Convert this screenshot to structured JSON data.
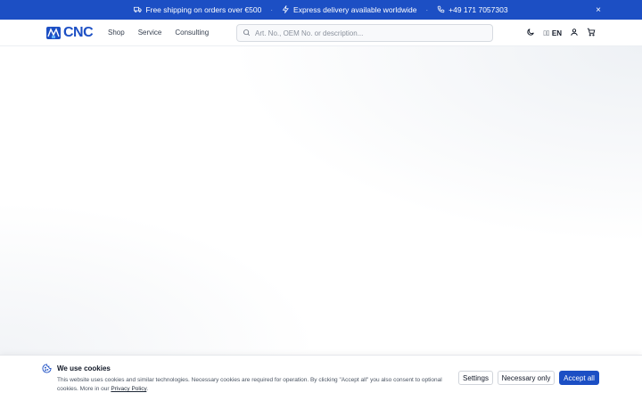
{
  "topbar": {
    "shipping": "Free shipping on orders over €500",
    "delivery": "Express delivery available worldwide",
    "phone": "+49 171 7057303",
    "separator": "·",
    "close": "×"
  },
  "header": {
    "logo_text": "CNC",
    "nav": [
      "Shop",
      "Service",
      "Consulting"
    ],
    "search_placeholder": "Art. No., OEM No. or description...",
    "language_flag": "▯▯",
    "language": "EN"
  },
  "cookie": {
    "title": "We use cookies",
    "text": "This website uses cookies and similar technologies. Necessary cookies are required for operation. By clicking \"Accept all\" you also consent to optional cookies. More in our ",
    "link": "Privacy Policy",
    "text_end": ".",
    "settings": "Settings",
    "necessary": "Necessary only",
    "accept": "Accept all"
  },
  "colors": {
    "brand": "#1c4fc4",
    "accent": "#1c4fc4"
  },
  "icons": [
    "truck-icon",
    "lightning-icon",
    "phone-icon",
    "close-icon",
    "search-icon",
    "moon-icon",
    "user-icon",
    "cart-icon",
    "cookie-icon"
  ]
}
